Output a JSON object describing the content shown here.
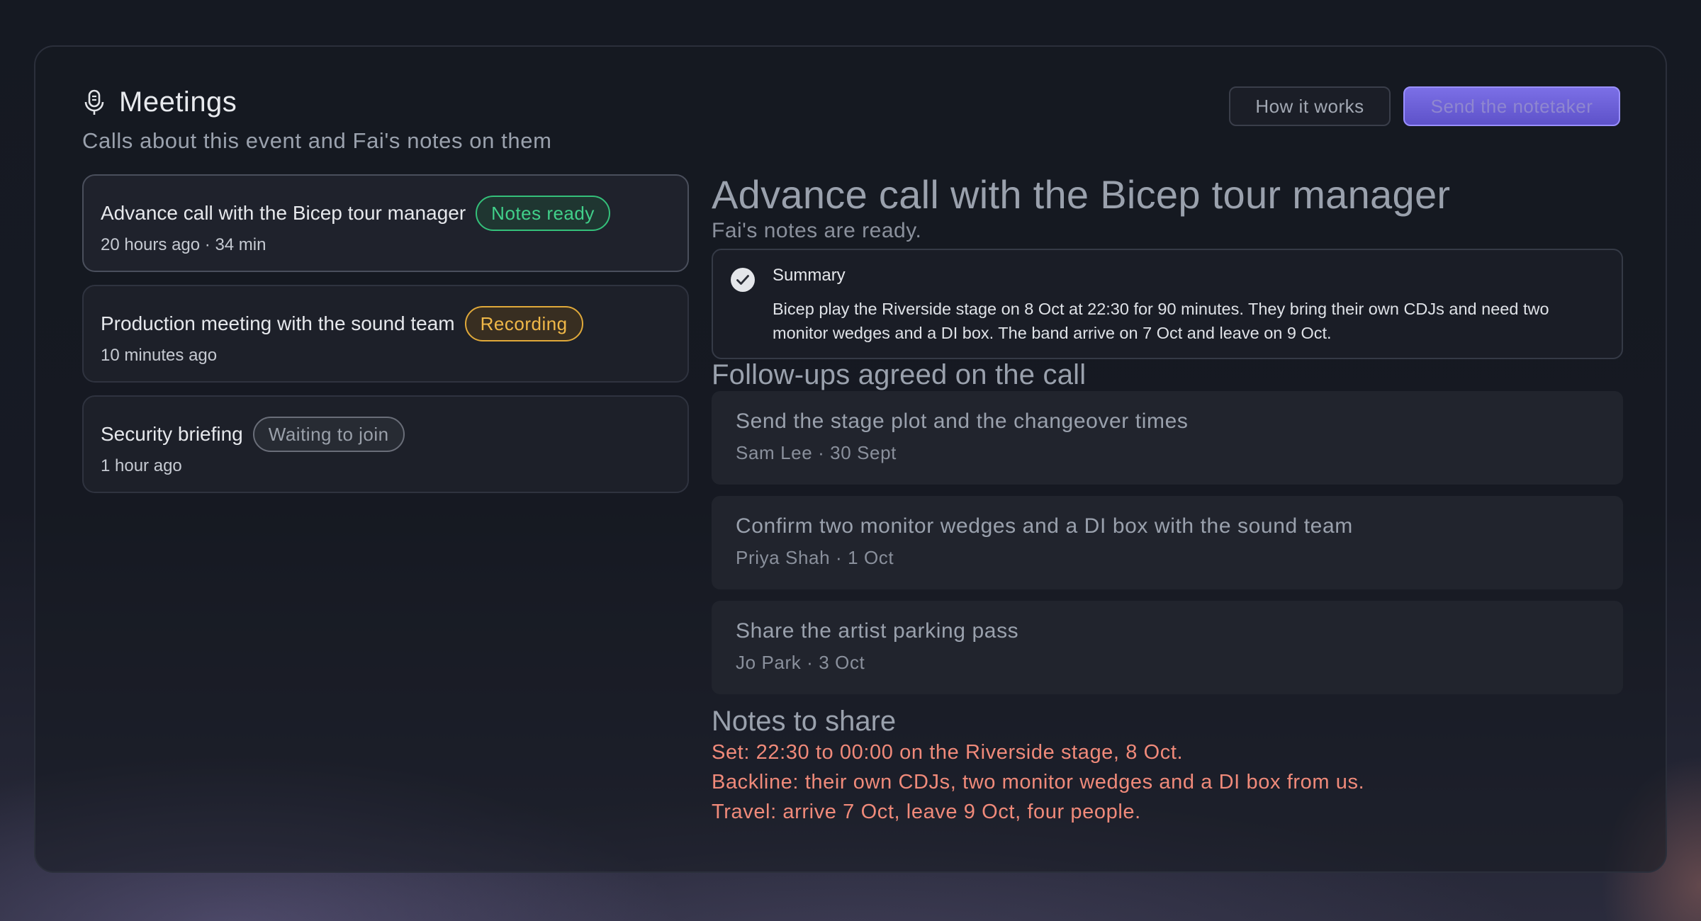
{
  "header": {
    "title": "Meetings",
    "subtitle": "Calls about this event and Fai's notes on them",
    "icon": "microphone-icon"
  },
  "buttons": {
    "how_it_works": "How it works",
    "send_notetaker": "Send the notetaker"
  },
  "meetings": [
    {
      "title": "Advance call with the Bicep tour manager",
      "badge": "Notes ready",
      "badge_status": "green",
      "meta": "20 hours ago · 34 min",
      "selected": true
    },
    {
      "title": "Production meeting with the sound team",
      "badge": "Recording",
      "badge_status": "yellow",
      "meta": "10 minutes ago",
      "selected": false
    },
    {
      "title": "Security briefing",
      "badge": "Waiting to join",
      "badge_status": "gray",
      "meta": "1 hour ago",
      "selected": false
    }
  ],
  "detail": {
    "title": "Advance call with the Bicep tour manager",
    "subtitle": "Fai's notes are ready.",
    "summary": {
      "label": "Summary",
      "text": "Bicep play the Riverside stage on 8 Oct at 22:30 for 90 minutes. They bring their own CDJs and need two monitor wedges and a DI box. The band arrive on 7 Oct and leave on 9 Oct."
    },
    "followups_title": "Follow-ups agreed on the call",
    "followups": [
      {
        "title": "Send the stage plot and the changeover times",
        "meta": "Sam Lee · 30 Sept"
      },
      {
        "title": "Confirm two monitor wedges and a DI box with the sound team",
        "meta": "Priya Shah · 1 Oct"
      },
      {
        "title": "Share the artist parking pass",
        "meta": "Jo Park · 3 Oct"
      }
    ],
    "notes_title": "Notes to share",
    "notes": [
      "Set: 22:30 to 00:00 on the Riverside stage, 8 Oct.",
      "Backline: their own CDJs, two monitor wedges and a DI box from us.",
      "Travel: arrive 7 Oct, leave 9 Oct, four people."
    ]
  },
  "colors": {
    "accent": "#6f63dd",
    "status_green": "#41d08a",
    "status_yellow": "#f0b848",
    "status_gray": "#9aa0aa",
    "notes_text": "#f08a7a"
  }
}
